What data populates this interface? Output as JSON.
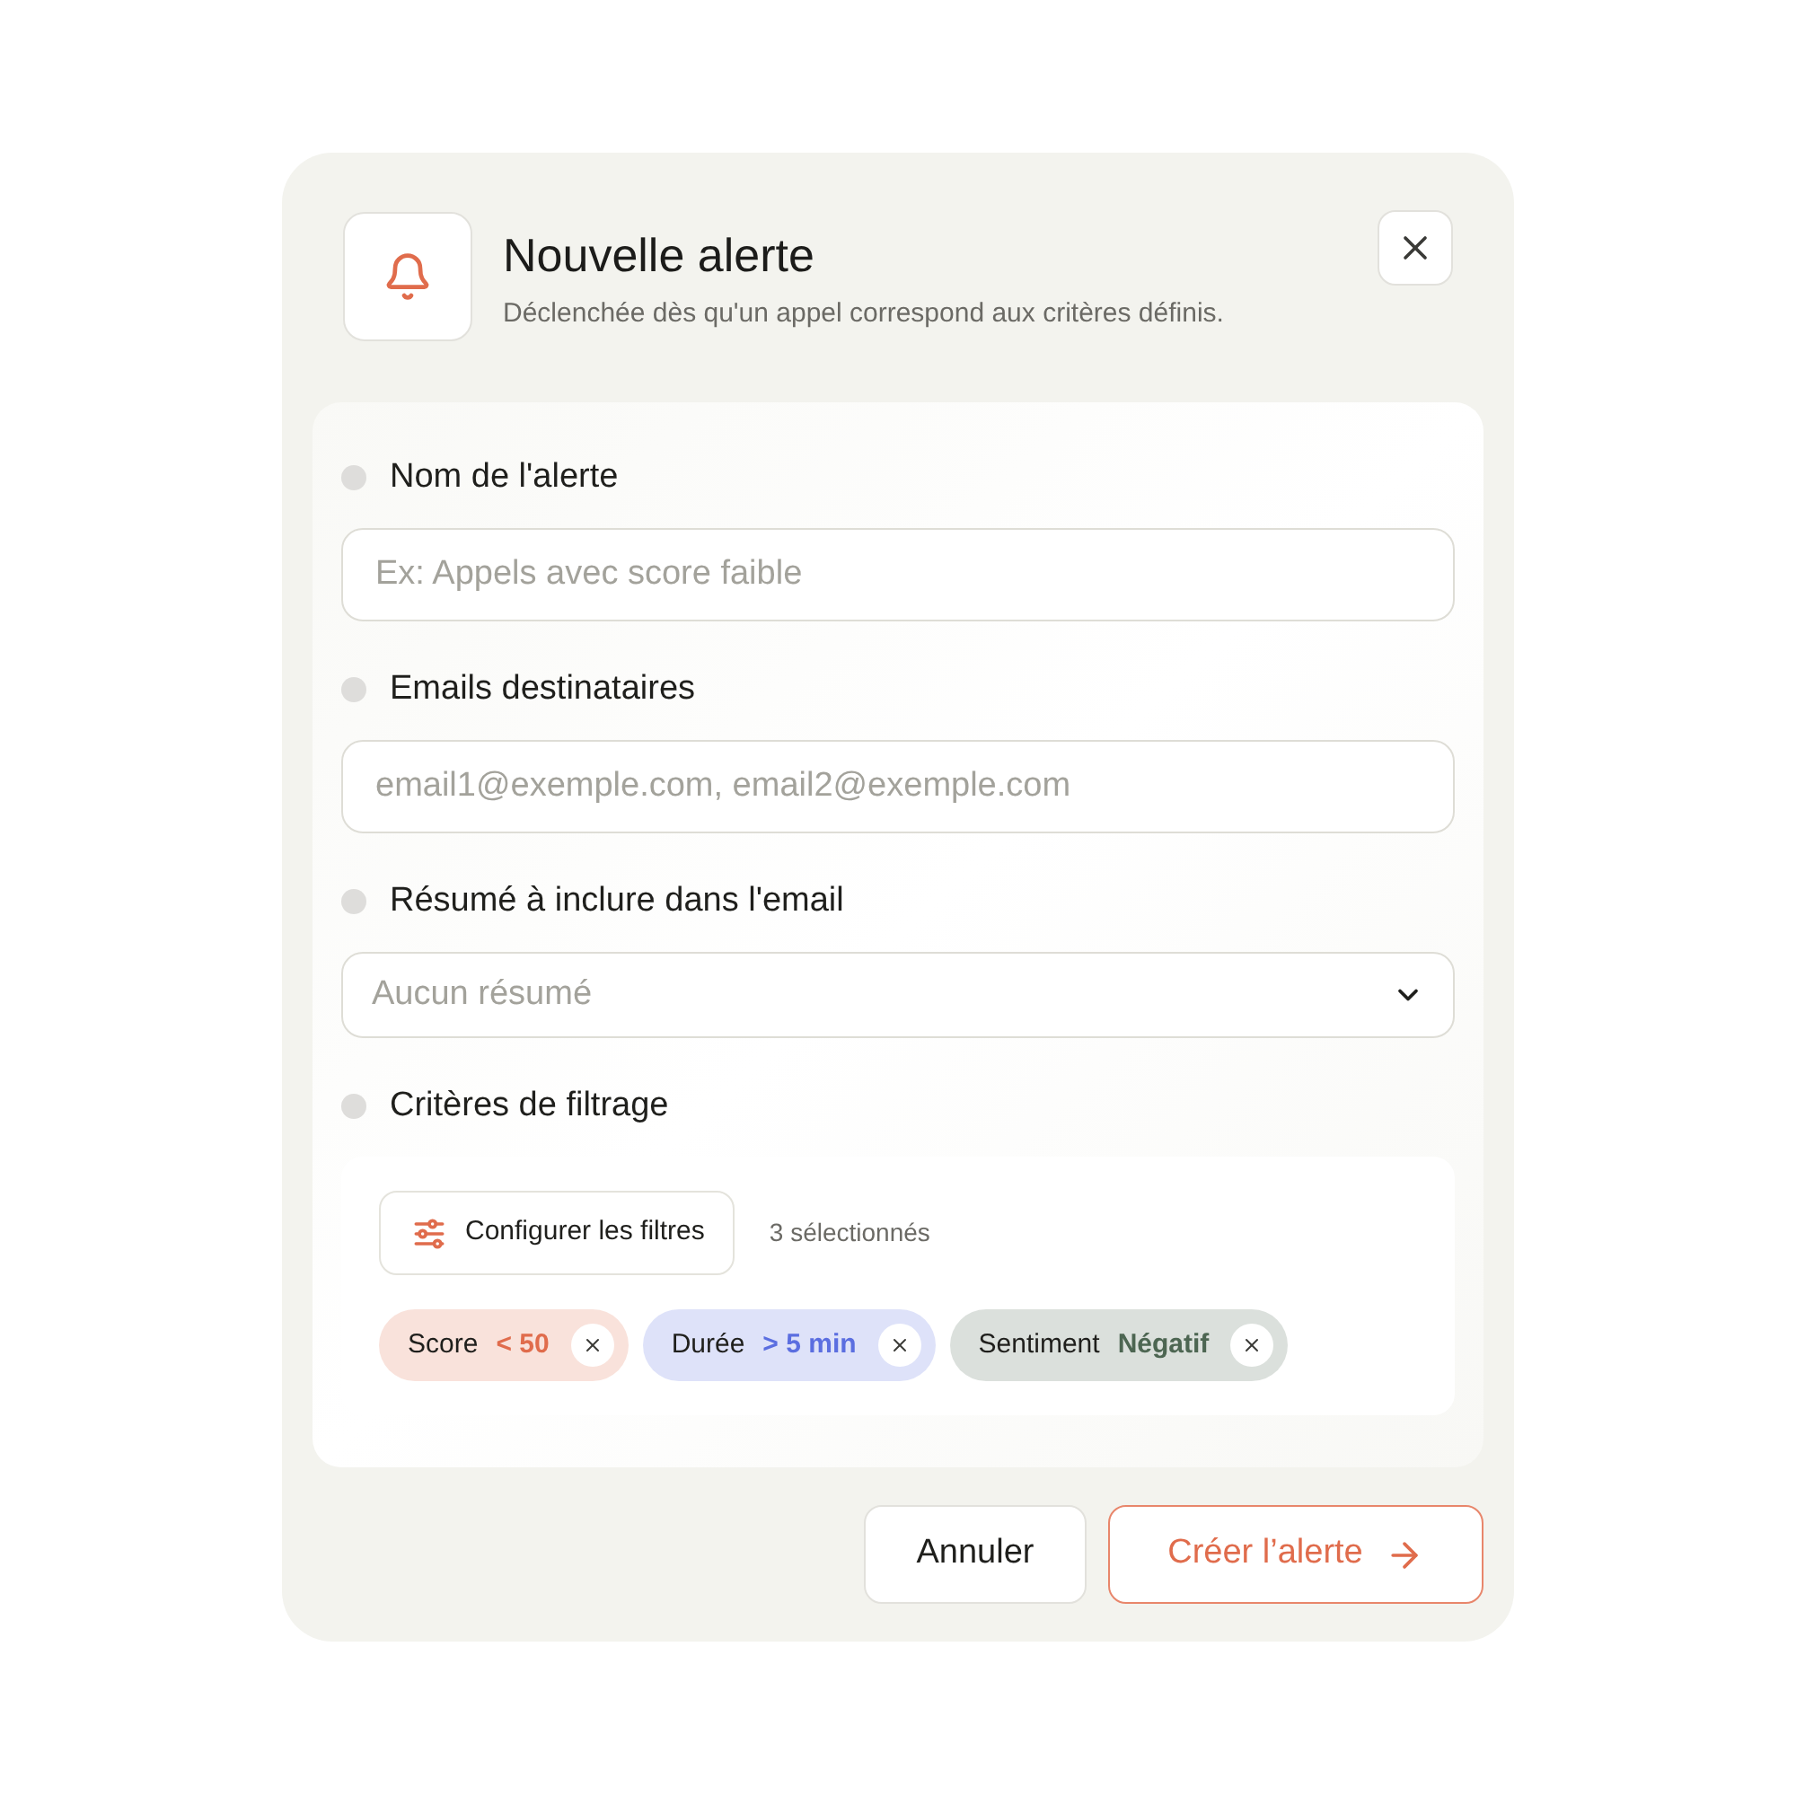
{
  "header": {
    "title": "Nouvelle alerte",
    "subtitle": "Déclenchée dès qu'un appel correspond aux critères définis."
  },
  "fields": [
    {
      "kind": "input",
      "label": "Nom de l'alerte",
      "placeholder": "Ex: Appels avec score faible"
    },
    {
      "kind": "input",
      "label": "Emails destinataires",
      "placeholder": "email1@exemple.com, email2@exemple.com"
    },
    {
      "kind": "select",
      "label": "Résumé à inclure dans l'email",
      "placeholder": "Aucun résumé"
    }
  ],
  "filters": {
    "label": "Critères de filtrage",
    "configure_button": "Configurer les filtres",
    "count": "3 sélectionnés",
    "chips": [
      {
        "name": "Score",
        "value": "< 50",
        "color": "#e06c4c"
      },
      {
        "name": "Durée",
        "value": "> 5 min",
        "color": "#5b6ee0"
      },
      {
        "name": "Sentiment",
        "value": "Négatif",
        "color": "#4d6652"
      }
    ]
  },
  "buttons": {
    "cancel": "Annuler",
    "submit": "Créer l’alerte"
  }
}
